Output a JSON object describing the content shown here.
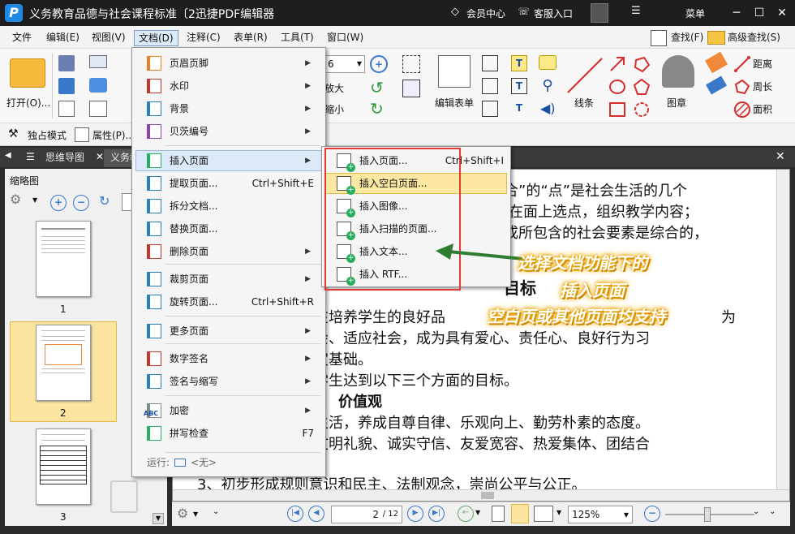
{
  "window": {
    "title": "义务教育品德与社会课程标准〔2迅捷PDF编辑器",
    "member": "会员中心",
    "service": "客服入口",
    "menu": "菜单",
    "logo_letter": "P"
  },
  "menubar": {
    "items": [
      "文件",
      "编辑(E)",
      "视图(V)",
      "文档(D)",
      "注释(C)",
      "表单(R)",
      "工具(T)",
      "窗口(W)"
    ],
    "find": "查找(F)",
    "advanced_find": "高级查找(S)"
  },
  "toolbar": {
    "open": "打开(O)...",
    "zoom_value": "6",
    "zoom_in_label": "放大",
    "zoom_out_label": "缩小",
    "edit_form": "编辑表单",
    "line": "线条",
    "stamp": "图章",
    "distance": "距离",
    "perimeter": "周长",
    "area": "面积",
    "exclusive": "独占模式",
    "properties": "属性(P)..."
  },
  "tabs": {
    "mindmap": "思维导图",
    "doc": "义务教"
  },
  "panel": {
    "title": "缩略图",
    "pages": [
      "1",
      "2",
      "3"
    ]
  },
  "doc_menu": {
    "items": [
      {
        "label": "页眉页脚",
        "shortcut": "",
        "arrow": "▶"
      },
      {
        "label": "水印",
        "shortcut": "",
        "arrow": "▶"
      },
      {
        "label": "背景",
        "shortcut": "",
        "arrow": "▶"
      },
      {
        "label": "贝茨编号",
        "shortcut": "",
        "arrow": "▶"
      },
      {
        "label": "插入页面",
        "shortcut": "",
        "arrow": "▶"
      },
      {
        "label": "提取页面...",
        "shortcut": "Ctrl+Shift+E",
        "arrow": ""
      },
      {
        "label": "拆分文档...",
        "shortcut": "",
        "arrow": ""
      },
      {
        "label": "替换页面...",
        "shortcut": "",
        "arrow": ""
      },
      {
        "label": "删除页面",
        "shortcut": "",
        "arrow": "▶"
      },
      {
        "label": "裁剪页面",
        "shortcut": "",
        "arrow": "▶"
      },
      {
        "label": "旋转页面...",
        "shortcut": "Ctrl+Shift+R",
        "arrow": ""
      },
      {
        "label": "更多页面",
        "shortcut": "",
        "arrow": "▶"
      },
      {
        "label": "数字签名",
        "shortcut": "",
        "arrow": "▶"
      },
      {
        "label": "签名与缩写",
        "shortcut": "",
        "arrow": "▶"
      },
      {
        "label": "加密",
        "shortcut": "",
        "arrow": "▶"
      },
      {
        "label": "拼写检查",
        "shortcut": "F7",
        "arrow": ""
      }
    ],
    "run_label": "运行:",
    "run_value": "<无>",
    "abc": "ABC"
  },
  "submenu": {
    "items": [
      {
        "label": "插入页面...",
        "shortcut": "Ctrl+Shift+I"
      },
      {
        "label": "插入空白页面...",
        "shortcut": ""
      },
      {
        "label": "插入图像...",
        "shortcut": ""
      },
      {
        "label": "插入扫描的页面...",
        "shortcut": ""
      },
      {
        "label": "插入文本...",
        "shortcut": ""
      },
      {
        "label": "插入 RTF...",
        "shortcut": ""
      }
    ]
  },
  "document": {
    "lines": [
      "合”的“点”是社会生活的几个",
      "在面上选点，组织教学内容；",
      "成所包含的社会要素是综合的，",
      "目标",
      "旨在培养学生的良好品",
      "社会、适应社会，成为具有爱心、责任心、良好行为习",
      "奠定基础。",
      "助学生达到以下三个方面的目标。",
      "价值观",
      "爱生活，养成自尊自律、乐观向上、勤劳朴素的态度。",
      "成文明礼貌、诚实守信、友爱宽容、热爱集体、团结合",
      "。",
      "3、初步形成规则意识和民主、法制观念，崇尚公平与公正。"
    ],
    "partial_right": "为"
  },
  "annotation": {
    "line1": "选择文档功能下的",
    "line2": "插入页面",
    "line3": "空白页或其他页面均支持",
    "color": "#f0b000",
    "arrow_color": "#2e7d32",
    "box_color": "#e53935"
  },
  "statusbar": {
    "page_value": "2",
    "page_total": "/ 12",
    "zoom": "125%"
  }
}
